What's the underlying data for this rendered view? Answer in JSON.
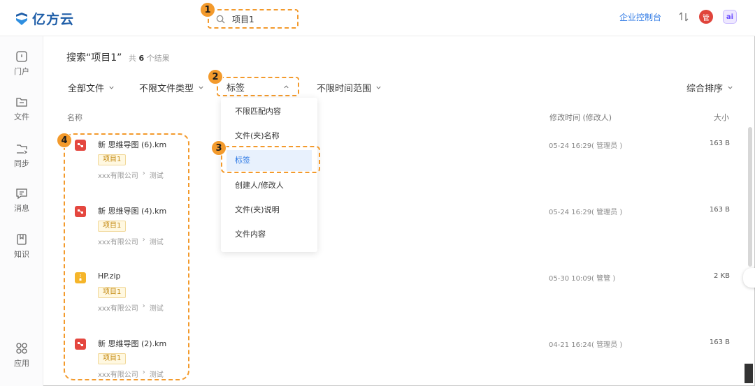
{
  "header": {
    "logo_text": "亿方云",
    "search_value": "项目1",
    "console_link": "企业控制台",
    "avatar_text": "管",
    "ai_text": "ai"
  },
  "sidebar": {
    "items": [
      {
        "label": "门户",
        "icon": "home-icon"
      },
      {
        "label": "文件",
        "icon": "folder-icon"
      },
      {
        "label": "同步",
        "icon": "sync-folder-icon"
      },
      {
        "label": "消息",
        "icon": "message-icon"
      },
      {
        "label": "知识",
        "icon": "knowledge-icon"
      },
      {
        "label": "应用",
        "icon": "apps-icon"
      }
    ]
  },
  "search": {
    "title": "搜索“项目1”",
    "count_prefix": "共",
    "count": "6",
    "count_suffix": "个结果"
  },
  "filters": {
    "all_files": "全部文件",
    "file_type": "不限文件类型",
    "tag": "标签",
    "time_range": "不限时间范围",
    "sort": "综合排序"
  },
  "columns": {
    "name": "名称",
    "modified": "修改时间 (修改人)",
    "size": "大小"
  },
  "files": [
    {
      "name": "新 思维导图 (6).km",
      "tag": "项目1",
      "path_org": "xxx有限公司",
      "path_folder": "测试",
      "time": "05-24 16:29( 管理员 )",
      "size": "163 B",
      "icon": "mindmap-file-icon",
      "icon_color": "#e4473f"
    },
    {
      "name": "新 思维导图 (4).km",
      "tag": "项目1",
      "path_org": "xxx有限公司",
      "path_folder": "测试",
      "time": "05-24 16:29( 管理员 )",
      "size": "163 B",
      "icon": "mindmap-file-icon",
      "icon_color": "#e4473f"
    },
    {
      "name": "HP.zip",
      "tag": "项目1",
      "path_org": "xxx有限公司",
      "path_folder": "测试",
      "time": "05-30 10:09( 管管 )",
      "size": "2 KB",
      "icon": "zip-file-icon",
      "icon_color": "#f5b52a"
    },
    {
      "name": "新 思维导图 (2).km",
      "tag": "项目1",
      "path_org": "xxx有限公司",
      "path_folder": "测试",
      "time": "04-21 16:24( 管理员 )",
      "size": "163 B",
      "icon": "mindmap-file-icon",
      "icon_color": "#e4473f"
    }
  ],
  "dropdown": {
    "options": [
      "不限匹配内容",
      "文件(夹)名称",
      "标签",
      "创建人/修改人",
      "文件(夹)说明",
      "文件内容"
    ],
    "selected": "标签"
  },
  "markers": [
    "1",
    "2",
    "3",
    "4"
  ],
  "colors": {
    "accent": "#2f7ae5",
    "highlight": "#f39a2c"
  }
}
